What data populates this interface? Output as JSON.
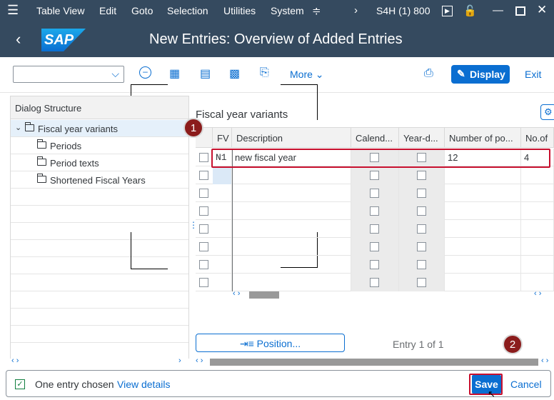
{
  "menubar": {
    "items": [
      "Table View",
      "Edit",
      "Goto",
      "Selection",
      "Utilities",
      "System"
    ],
    "system_name": "S4H (1) 800"
  },
  "titlebar": {
    "logo_text": "SAP",
    "title": "New Entries: Overview of Added Entries"
  },
  "toolbar": {
    "more_label": "More",
    "display_label": "Display",
    "exit_label": "Exit"
  },
  "dialog_structure": {
    "header": "Dialog Structure",
    "items": [
      "Fiscal year variants",
      "Periods",
      "Period texts",
      "Shortened Fiscal Years"
    ]
  },
  "grid": {
    "title": "Fiscal year variants",
    "columns": [
      "FV",
      "Description",
      "Calend...",
      "Year-d...",
      "Number of po...",
      "No.of"
    ],
    "rows": [
      {
        "fv": "N1",
        "description": "new fiscal year",
        "calendar_year": false,
        "year_dependent": false,
        "num_periods": "12",
        "special_periods": "4"
      }
    ],
    "empty_rows": 7
  },
  "position_button": "Position...",
  "entry_info": "Entry 1 of 1",
  "callouts": [
    "1",
    "2"
  ],
  "footer": {
    "status": "One entry chosen",
    "view_details": "View details",
    "save_label": "Save",
    "cancel_label": "Cancel"
  },
  "colors": {
    "shell": "#354a5f",
    "accent": "#0a6ed1",
    "highlight": "#c8102e",
    "badge": "#8b1c1c"
  }
}
